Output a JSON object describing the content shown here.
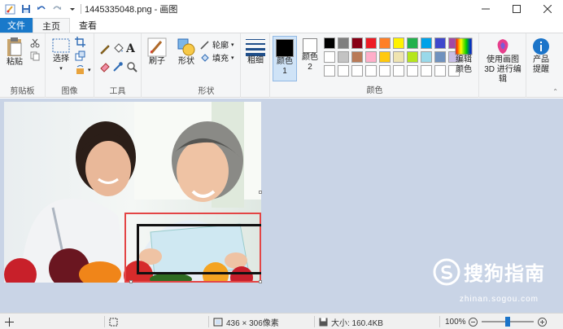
{
  "window": {
    "title": "1445335048.png - 画图"
  },
  "tabs": [
    {
      "label": "文件"
    },
    {
      "label": "主页"
    },
    {
      "label": "查看"
    }
  ],
  "ribbon": {
    "clipboard": {
      "paste": "粘贴",
      "group": "剪贴板"
    },
    "image": {
      "select": "选择",
      "group": "图像"
    },
    "tools": {
      "group": "工具",
      "text_glyph": "A"
    },
    "brush": "刷子",
    "shapes": {
      "shape": "形状",
      "outline": "轮廓",
      "fill": "填充",
      "group": "形状"
    },
    "size": "粗细",
    "color1": "颜色 1",
    "color2": "颜色 2",
    "colors_group": "颜色",
    "edit_colors": "编辑颜色",
    "paint3d": "使用画图 3D 进行编辑",
    "product_alert": "产品提醒",
    "palette": [
      "#000000",
      "#7f7f7f",
      "#880015",
      "#ed1c24",
      "#ff7f27",
      "#fff200",
      "#22b14c",
      "#00a2e8",
      "#3f48cc",
      "#a349a4",
      "#ffffff",
      "#c3c3c3",
      "#b97a57",
      "#ffaec9",
      "#ffc90e",
      "#efe4b0",
      "#b5e61d",
      "#99d9ea",
      "#7092be",
      "#c8bfe7",
      "#ffffff",
      "#ffffff",
      "#ffffff",
      "#ffffff",
      "#ffffff",
      "#ffffff",
      "#ffffff",
      "#ffffff",
      "#ffffff",
      "#ffffff"
    ]
  },
  "watermark": {
    "text": "搜狗指南",
    "url": "zhinan.sogou.com"
  },
  "status": {
    "dimensions": "436 × 306像素",
    "size": "大小: 160.4KB",
    "zoom": "100%",
    "zoom_level": 0.5
  }
}
